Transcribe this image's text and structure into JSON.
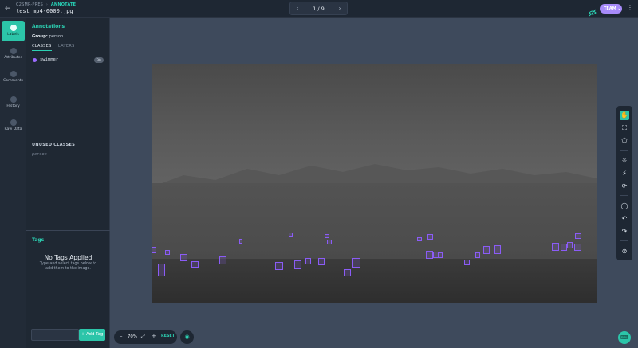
{
  "header": {
    "breadcrumb_project": "C2SMR-PRES",
    "breadcrumb_sep": "›",
    "breadcrumb_mode": "ANNOTATE",
    "filename": "test_mp4-0000.jpg",
    "page_indicator": "1 / 9",
    "team_label": "TEAM",
    "more": "⋮"
  },
  "rail": {
    "items": [
      {
        "label": "Labels"
      },
      {
        "label": "Attributes"
      },
      {
        "label": "Comments"
      },
      {
        "label": "History"
      },
      {
        "label": "Raw Data"
      }
    ]
  },
  "panel": {
    "title": "Annotations",
    "group_prefix": "Group:",
    "group_value": "person",
    "tabs": [
      {
        "label": "CLASSES"
      },
      {
        "label": "LAYERS"
      }
    ],
    "classes": [
      {
        "name": "swimmer",
        "count": "30",
        "color": "#9b6bff"
      }
    ],
    "unused_title": "UNUSED CLASSES",
    "unused": [
      {
        "name": "person"
      }
    ]
  },
  "tags": {
    "title": "Tags",
    "empty_title": "No Tags Applied",
    "empty_sub": "Type and select tags below to add them to the image.",
    "input_placeholder": "",
    "add_label": "+ Add Tag"
  },
  "zoom": {
    "minus": "–",
    "value": "70%",
    "plus": "+",
    "reset": "RESET"
  },
  "colors": {
    "accent": "#2cc5a9",
    "bbox": "#8b5cf6",
    "team": "#a78bfa"
  },
  "toolbar_icons": [
    "hand-icon",
    "bounding-box-icon",
    "polygon-icon",
    "brightness-icon",
    "magic-wand-icon",
    "repeat-icon",
    "comment-icon",
    "undo-icon",
    "redo-icon",
    "hide-annotations-icon"
  ]
}
